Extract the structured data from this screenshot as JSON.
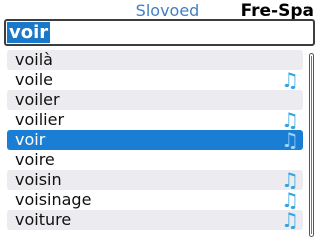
{
  "header": {
    "app_name": "Slovoed",
    "dictionary": "Fre-Spa"
  },
  "search": {
    "value": "voir"
  },
  "colors": {
    "accent": "#1a7fd4",
    "note_icon": "#2ea4e4",
    "row_alt": "#ebebf0"
  },
  "list": {
    "items": [
      {
        "label": "voilà",
        "audio": false,
        "alt": true,
        "selected": false
      },
      {
        "label": "voile",
        "audio": true,
        "alt": false,
        "selected": false
      },
      {
        "label": "voiler",
        "audio": false,
        "alt": true,
        "selected": false
      },
      {
        "label": "voilier",
        "audio": true,
        "alt": false,
        "selected": false
      },
      {
        "label": "voir",
        "audio": true,
        "alt": false,
        "selected": true
      },
      {
        "label": "voire",
        "audio": false,
        "alt": false,
        "selected": false
      },
      {
        "label": "voisin",
        "audio": true,
        "alt": true,
        "selected": false
      },
      {
        "label": "voisinage",
        "audio": true,
        "alt": false,
        "selected": false
      },
      {
        "label": "voiture",
        "audio": true,
        "alt": true,
        "selected": false
      }
    ],
    "audio_icon": "music-note-icon"
  },
  "scrollbar": {
    "position": 0
  }
}
